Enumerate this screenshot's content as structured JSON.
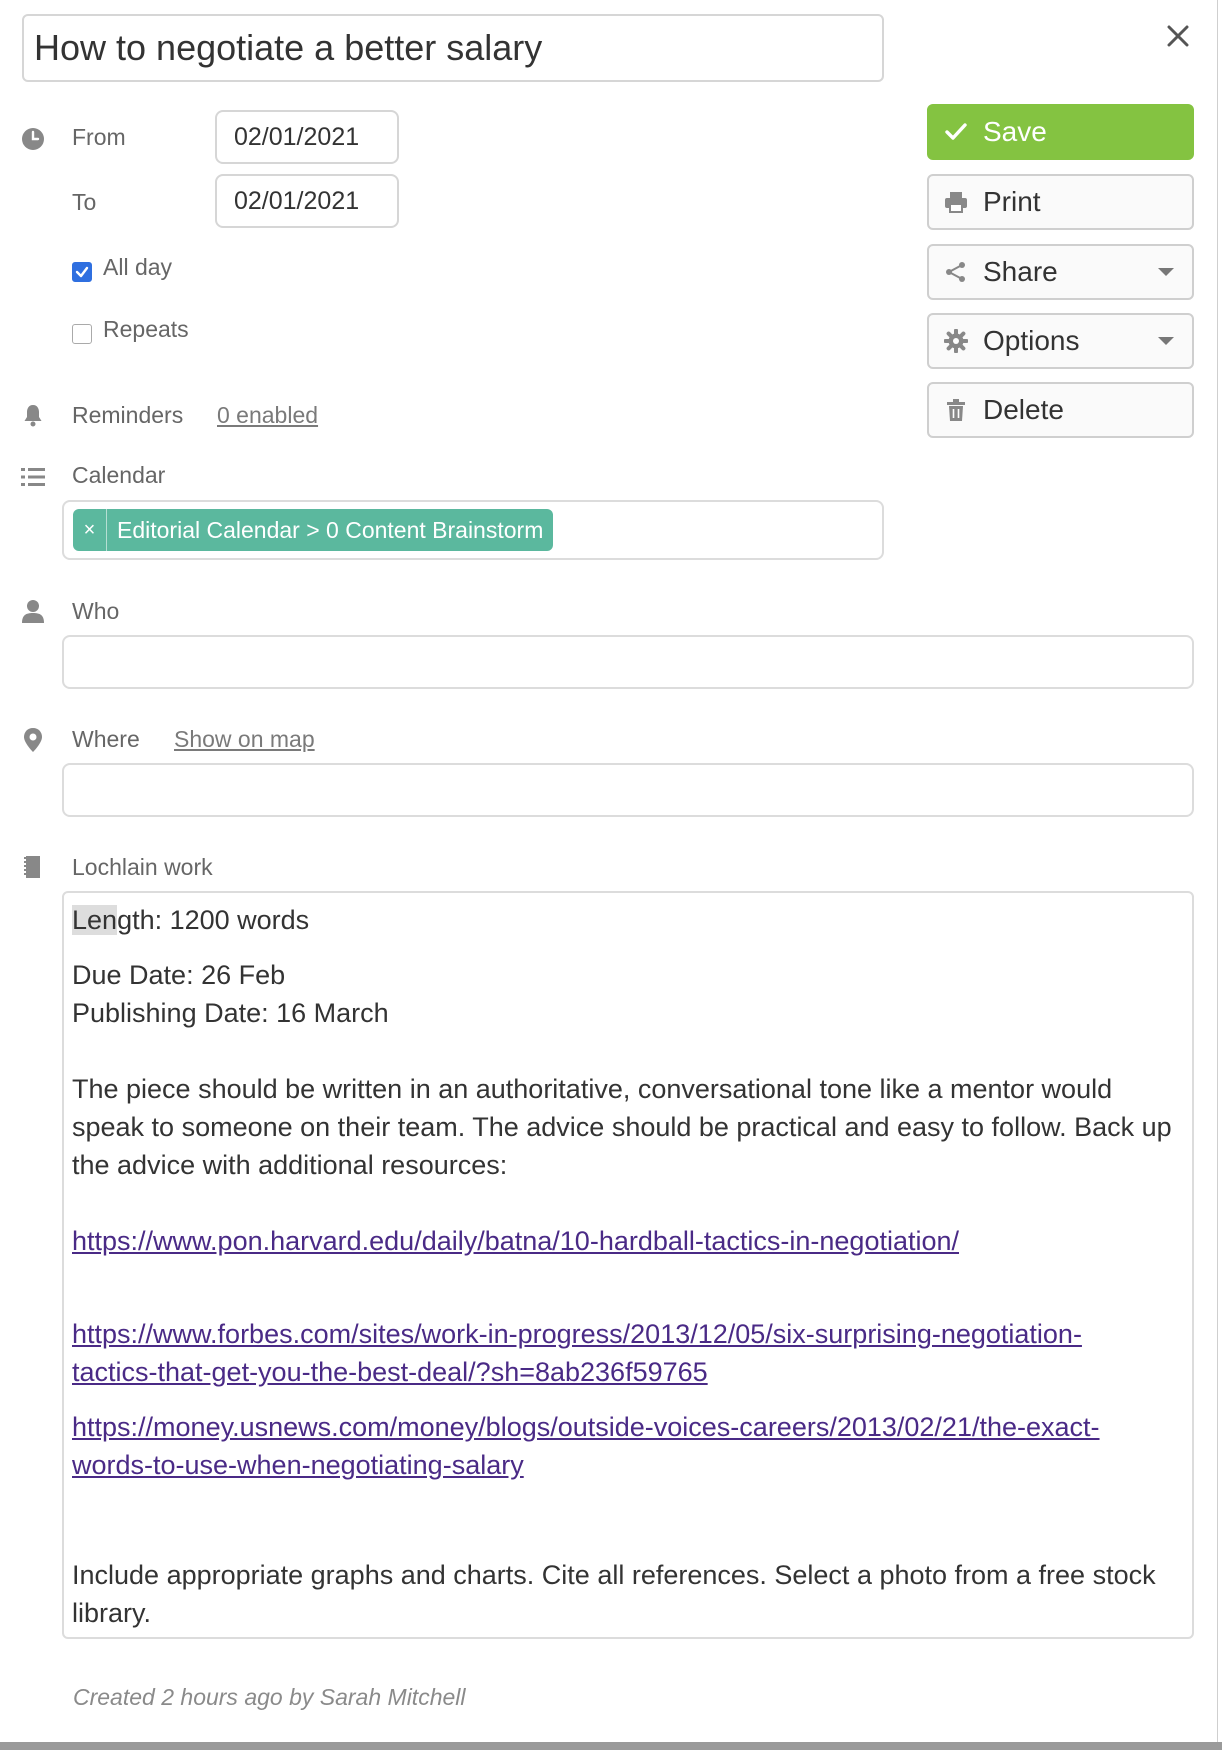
{
  "event": {
    "title": "How to negotiate a better salary"
  },
  "when": {
    "from_label": "From",
    "from_value": "02/01/2021",
    "to_label": "To",
    "to_value": "02/01/2021",
    "all_day_label": "All day",
    "all_day_checked": true,
    "repeats_label": "Repeats",
    "repeats_checked": false
  },
  "reminders": {
    "label": "Reminders",
    "link": "0 enabled"
  },
  "calendar": {
    "label": "Calendar",
    "tag_remove": "×",
    "tag": "Editorial Calendar > 0 Content Brainstorm"
  },
  "who": {
    "label": "Who",
    "value": ""
  },
  "where": {
    "label": "Where",
    "map_link": "Show on map",
    "value": ""
  },
  "notes": {
    "label": "Lochlain work",
    "length_hl": "Len",
    "length_rest": "gth: 1200 words",
    "due_date": "Due Date: 26 Feb",
    "publishing_date": "Publishing Date: 16 March",
    "paragraph": "The piece should be written in an authoritative, conversational tone like a mentor would speak to someone on their team. The advice should be practical and easy to follow. Back up the advice with additional resources:",
    "link1": "https://www.pon.harvard.edu/daily/batna/10-hardball-tactics-in-negotiation/",
    "link2_line1": "https://www.forbes.com/sites/work-in-progress/2013/12/05/six-surprising-negotiation-",
    "link2_line2": "tactics-that-get-you-the-best-deal/?sh=8ab236f59765",
    "link3_line1": "https://money.usnews.com/money/blogs/outside-voices-careers/2013/02/21/the-exact-",
    "link3_line2": "words-to-use-when-negotiating-salary",
    "closing": "Include appropriate graphs and charts. Cite all references. Select a photo from a free stock library."
  },
  "actions": {
    "save": "Save",
    "print": "Print",
    "share": "Share",
    "options": "Options",
    "delete": "Delete"
  },
  "footer": {
    "created": "Created 2 hours ago by Sarah Mitchell"
  },
  "colors": {
    "save_green": "#84c341",
    "tag_teal": "#5bb89e",
    "checkbox_blue": "#2f6fe0",
    "link_purple": "#4a2a86"
  },
  "icons": {
    "close": "close-icon",
    "clock": "clock-icon",
    "bell": "bell-icon",
    "list": "list-icon",
    "person": "person-icon",
    "pin": "map-pin-icon",
    "notes": "notes-icon",
    "check": "check-icon",
    "printer": "printer-icon",
    "share": "share-icon",
    "gear": "gear-icon",
    "trash": "trash-icon"
  }
}
